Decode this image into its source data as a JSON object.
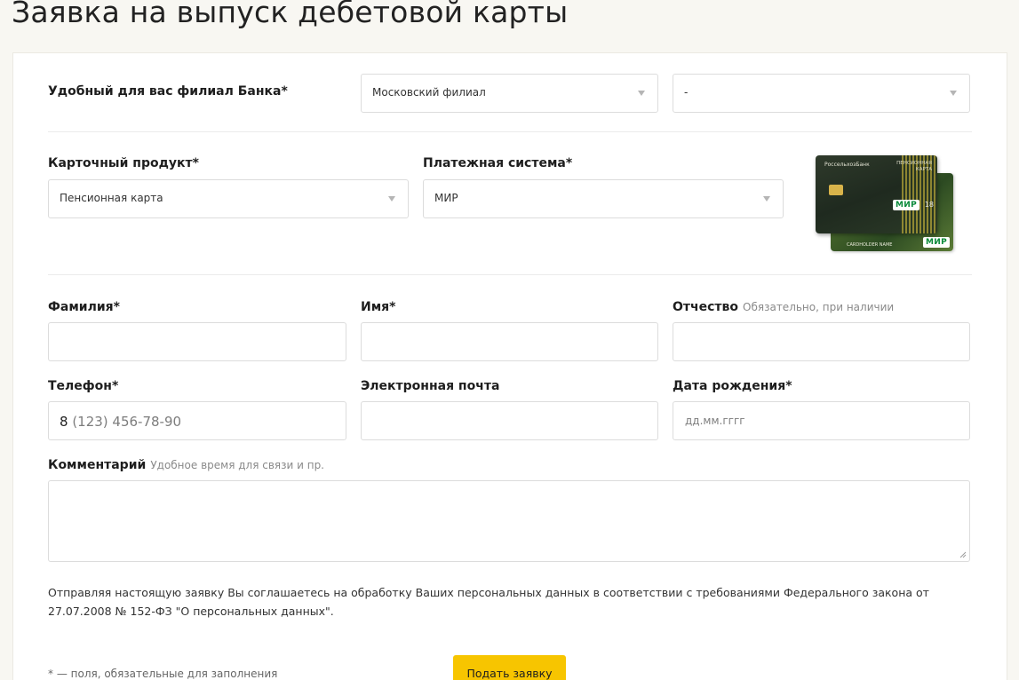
{
  "page": {
    "title": "Заявка на выпуск дебетовой карты"
  },
  "branch": {
    "label": "Удобный для вас филиал Банка*",
    "branch_value": "Московский филиал",
    "office_value": "-"
  },
  "card": {
    "product_label": "Карточный продукт*",
    "product_value": "Пенсионная карта",
    "system_label": "Платежная система*",
    "system_value": "МИР",
    "image": {
      "bank_name": "РоссельхозБанк",
      "product_text_1": "ПЕНСИОННАЯ",
      "product_text_2": "КАРТА",
      "brand": "МИР",
      "holder": "CARDHOLDER NAME",
      "age_mark": "18"
    }
  },
  "person": {
    "surname_label": "Фамилия*",
    "name_label": "Имя*",
    "patronymic_label": "Отчество",
    "patronymic_hint": "Обязательно, при наличии",
    "phone_label": "Телефон*",
    "phone_prefix": "8",
    "phone_placeholder": "(123) 456-78-90",
    "email_label": "Электронная почта",
    "birth_label": "Дата рождения*",
    "birth_placeholder": "дд.мм.гггг"
  },
  "comment": {
    "label": "Комментарий",
    "hint": "Удобное время для связи и пр."
  },
  "consent_text": "Отправляя настоящую заявку Вы соглашаетесь на обработку Ваших персональных данных в соответствии с требованиями Федерального закона от 27.07.2008 № 152-ФЗ \"О персональных данных\".",
  "footnote": "* — поля, обязательные для заполнения",
  "submit_label": "Подать заявку",
  "colors": {
    "accent": "#f7c500",
    "border": "#dcdcdc",
    "background": "#f8f7f2"
  }
}
